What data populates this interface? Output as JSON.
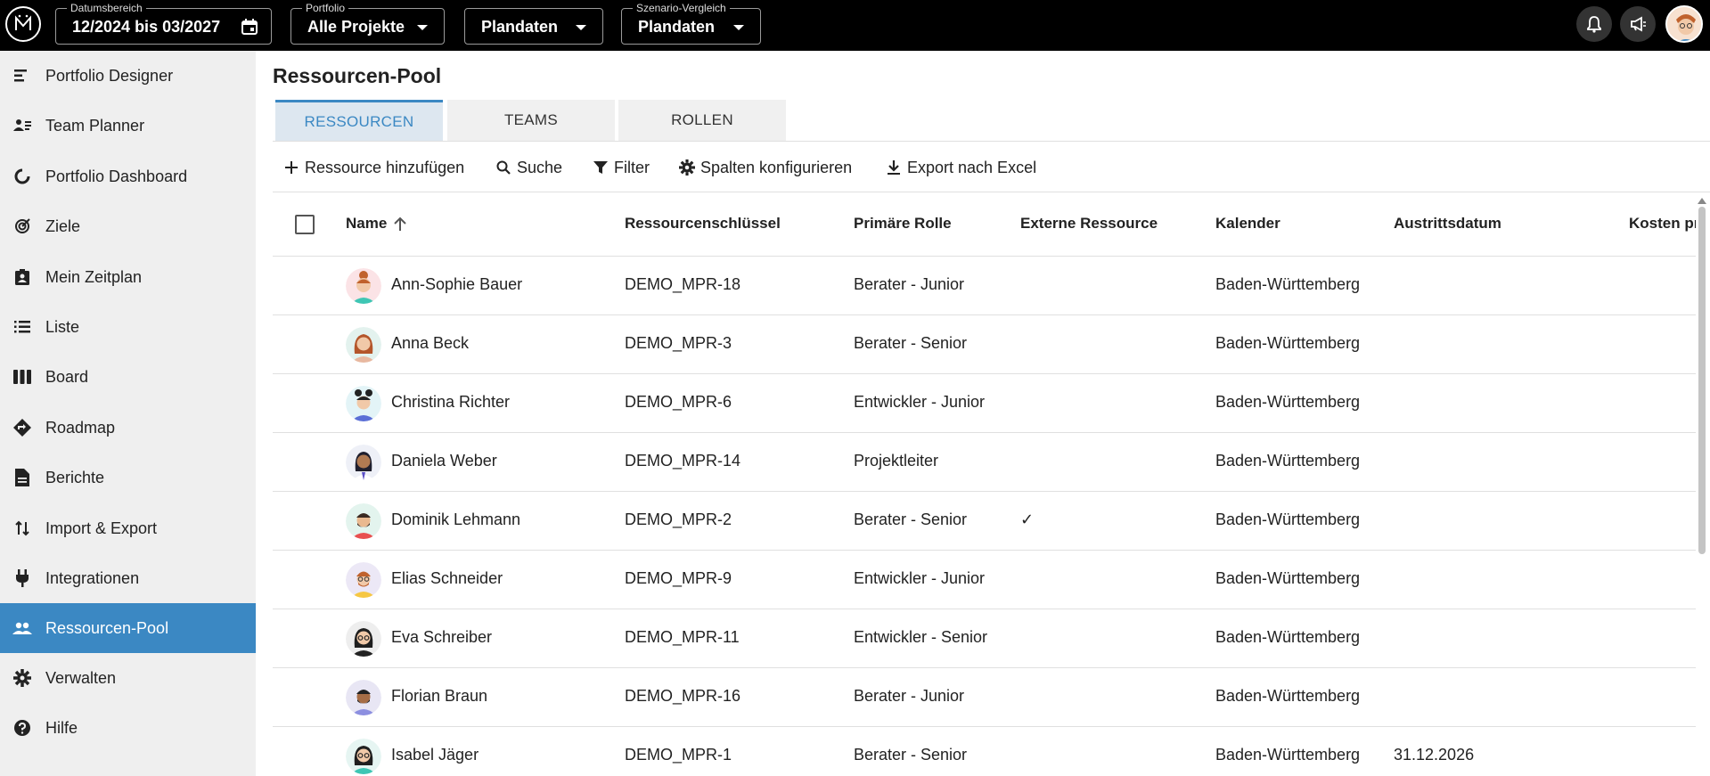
{
  "topbar": {
    "date_range": {
      "label": "Datumsbereich",
      "value": "12/2024 bis 03/2027"
    },
    "portfolio": {
      "label": "Portfolio",
      "value": "Alle Projekte"
    },
    "data_source": {
      "value": "Plandaten"
    },
    "scenario": {
      "label": "Szenario-Vergleich",
      "value": "Plandaten"
    },
    "icons": [
      "bell-icon",
      "megaphone-icon",
      "user-avatar"
    ]
  },
  "sidebar": {
    "items": [
      {
        "label": "Portfolio Designer",
        "icon": "portfolio-designer-icon"
      },
      {
        "label": "Team Planner",
        "icon": "team-planner-icon"
      },
      {
        "label": "Portfolio Dashboard",
        "icon": "dashboard-icon"
      },
      {
        "label": "Ziele",
        "icon": "target-icon"
      },
      {
        "label": "Mein Zeitplan",
        "icon": "clipboard-user-icon"
      },
      {
        "label": "Liste",
        "icon": "list-icon"
      },
      {
        "label": "Board",
        "icon": "board-icon"
      },
      {
        "label": "Roadmap",
        "icon": "roadmap-icon"
      },
      {
        "label": "Berichte",
        "icon": "report-icon"
      },
      {
        "label": "Import & Export",
        "icon": "import-export-icon"
      },
      {
        "label": "Integrationen",
        "icon": "plug-icon"
      },
      {
        "label": "Ressourcen-Pool",
        "icon": "people-icon"
      },
      {
        "label": "Verwalten",
        "icon": "gear-icon"
      },
      {
        "label": "Hilfe",
        "icon": "help-icon"
      }
    ],
    "active_index": 11
  },
  "main": {
    "title": "Ressourcen-Pool",
    "tabs": [
      {
        "label": "RESSOURCEN"
      },
      {
        "label": "TEAMS"
      },
      {
        "label": "ROLLEN"
      }
    ],
    "toolbar": {
      "add": "Ressource hinzufügen",
      "search": "Suche",
      "filter": "Filter",
      "columns": "Spalten konfigurieren",
      "export": "Export nach Excel"
    },
    "table": {
      "columns": [
        "Name",
        "Ressourcenschlüssel",
        "Primäre Rolle",
        "Externe Ressource",
        "Kalender",
        "Austrittsdatum",
        "Kosten pr"
      ],
      "rows": [
        {
          "name": "Ann-Sophie Bauer",
          "key": "DEMO_MPR-18",
          "role": "Berater - Junior",
          "external": "",
          "calendar": "Baden-Württemberg",
          "exit": ""
        },
        {
          "name": "Anna Beck",
          "key": "DEMO_MPR-3",
          "role": "Berater - Senior",
          "external": "",
          "calendar": "Baden-Württemberg",
          "exit": ""
        },
        {
          "name": "Christina Richter",
          "key": "DEMO_MPR-6",
          "role": "Entwickler - Junior",
          "external": "",
          "calendar": "Baden-Württemberg",
          "exit": ""
        },
        {
          "name": "Daniela Weber",
          "key": "DEMO_MPR-14",
          "role": "Projektleiter",
          "external": "",
          "calendar": "Baden-Württemberg",
          "exit": ""
        },
        {
          "name": "Dominik Lehmann",
          "key": "DEMO_MPR-2",
          "role": "Berater - Senior",
          "external": "✓",
          "calendar": "Baden-Württemberg",
          "exit": ""
        },
        {
          "name": "Elias Schneider",
          "key": "DEMO_MPR-9",
          "role": "Entwickler - Junior",
          "external": "",
          "calendar": "Baden-Württemberg",
          "exit": ""
        },
        {
          "name": "Eva Schreiber",
          "key": "DEMO_MPR-11",
          "role": "Entwickler - Senior",
          "external": "",
          "calendar": "Baden-Württemberg",
          "exit": ""
        },
        {
          "name": "Florian Braun",
          "key": "DEMO_MPR-16",
          "role": "Berater - Junior",
          "external": "",
          "calendar": "Baden-Württemberg",
          "exit": ""
        },
        {
          "name": "Isabel Jäger",
          "key": "DEMO_MPR-1",
          "role": "Berater - Senior",
          "external": "",
          "calendar": "Baden-Württemberg",
          "exit": "31.12.2026"
        }
      ]
    }
  },
  "colors": {
    "accent": "#3b88c3",
    "topbar": "#000000",
    "sidebar": "#efefef"
  }
}
